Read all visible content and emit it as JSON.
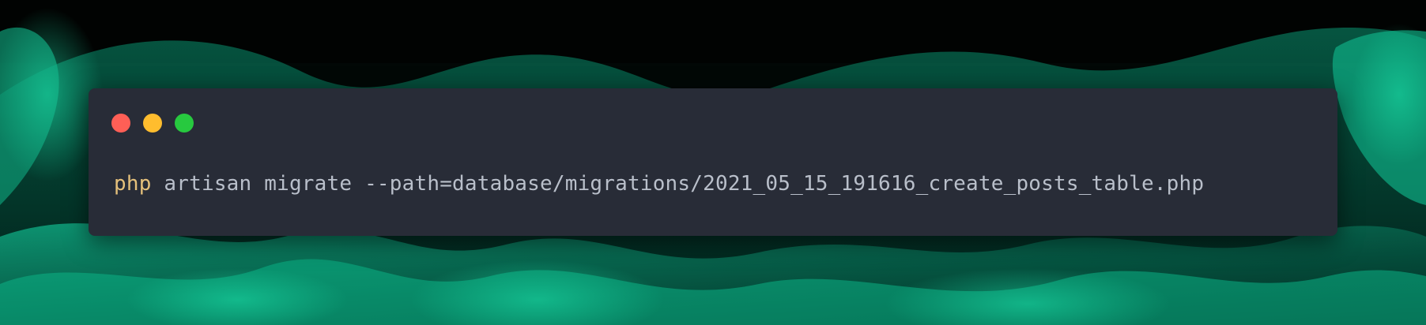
{
  "window": {
    "controls": [
      {
        "name": "close",
        "color": "#ff5f56"
      },
      {
        "name": "minimize",
        "color": "#ffbd2e"
      },
      {
        "name": "maximize",
        "color": "#27c93f"
      }
    ]
  },
  "code": {
    "keyword": "php",
    "rest": " artisan migrate --path=database/migrations/2021_05_15_191616_create_posts_table.php",
    "keyword_color": "#e5c07b",
    "text_color": "#b9bfca"
  },
  "colors": {
    "window_bg": "#282c37",
    "accent_green": "#1fbf8f"
  }
}
